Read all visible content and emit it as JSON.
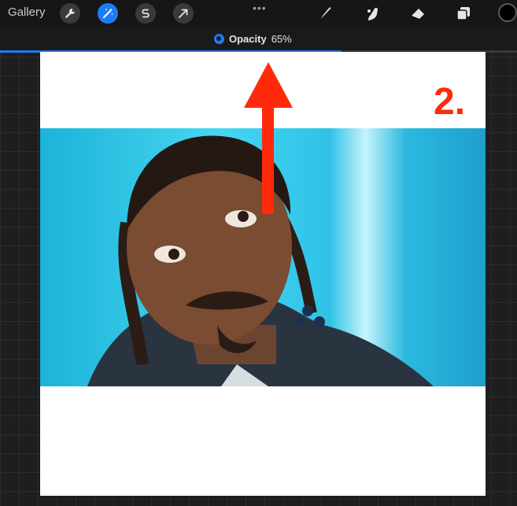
{
  "toolbar": {
    "gallery_label": "Gallery",
    "left_tools": [
      {
        "icon": "wrench-icon",
        "active": false
      },
      {
        "icon": "magic-wand-icon",
        "active": true
      },
      {
        "icon": "selection-icon",
        "active": false
      },
      {
        "icon": "transform-arrow-icon",
        "active": false
      }
    ],
    "more_label": "•••",
    "right_tools": [
      {
        "icon": "brush-icon"
      },
      {
        "icon": "smudge-icon"
      },
      {
        "icon": "eraser-icon"
      },
      {
        "icon": "layers-icon"
      }
    ],
    "color_swatch": "#000000"
  },
  "opacity_slider": {
    "label": "Opacity",
    "value_text": "65%",
    "value": 0.66,
    "accent": "#1c7cf4"
  },
  "canvas": {
    "photo": "portrait of a man with braided hair on a blue background",
    "annotation_label": "2.",
    "annotation_color": "#ff2a0c"
  }
}
